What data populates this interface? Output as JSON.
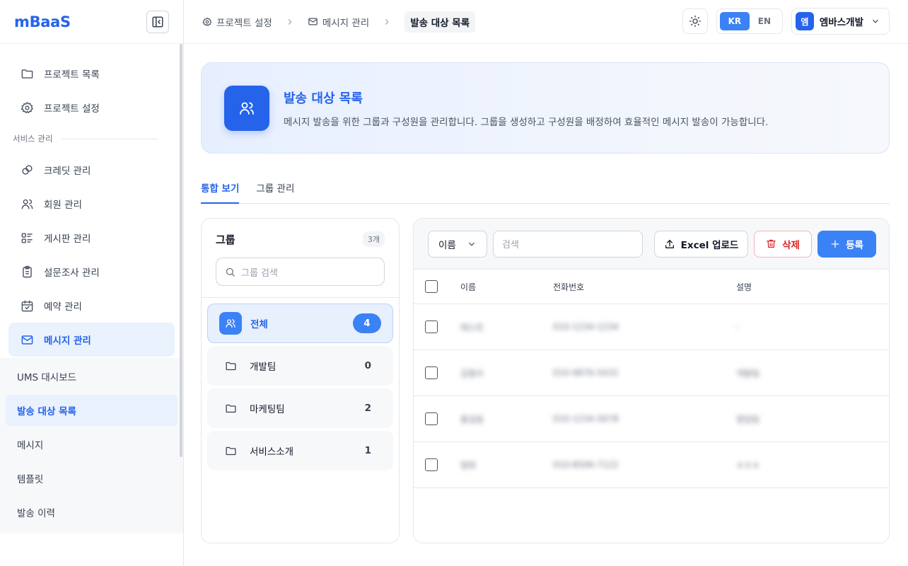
{
  "app": {
    "logo": "mBaaS"
  },
  "sidebar": {
    "items_top": [
      {
        "label": "프로젝트 목록",
        "icon": "folder-icon"
      },
      {
        "label": "프로젝트 설정",
        "icon": "gear-icon"
      }
    ],
    "section_label": "서비스 관리",
    "items_service": [
      {
        "label": "크레딧 관리",
        "icon": "coins-icon"
      },
      {
        "label": "회원 관리",
        "icon": "users-icon"
      },
      {
        "label": "게시판 관리",
        "icon": "list-icon"
      },
      {
        "label": "설문조사 관리",
        "icon": "clipboard-icon"
      },
      {
        "label": "예약 관리",
        "icon": "calendar-check-icon"
      },
      {
        "label": "메시지 관리",
        "icon": "mail-icon"
      }
    ],
    "submenu": [
      {
        "label": "UMS 대시보드"
      },
      {
        "label": "발송 대상 목록"
      },
      {
        "label": "메시지"
      },
      {
        "label": "템플릿"
      },
      {
        "label": "발송 이력"
      }
    ]
  },
  "breadcrumb": [
    {
      "label": "프로젝트 설정",
      "icon": "gear-icon"
    },
    {
      "label": "메시지 관리",
      "icon": "mail-icon"
    },
    {
      "label": "발송 대상 목록"
    }
  ],
  "header": {
    "lang": [
      "KR",
      "EN"
    ],
    "user_initial": "엠",
    "user_name": "엠바스개발"
  },
  "hero": {
    "title": "발송 대상 목록",
    "description": "메시지 발송을 위한 그룹과 구성원을 관리합니다. 그룹을 생성하고 구성원을 배정하여 효율적인 메시지 발송이 가능합니다."
  },
  "tabs": [
    {
      "label": "통합 보기"
    },
    {
      "label": "그룹 관리"
    }
  ],
  "groups": {
    "title": "그룹",
    "count": "3개",
    "search_placeholder": "그룹 검색",
    "items": [
      {
        "name": "전체",
        "count": "4"
      },
      {
        "name": "개발팀",
        "count": "0"
      },
      {
        "name": "마케팅팀",
        "count": "2"
      },
      {
        "name": "서비스소개",
        "count": "1"
      }
    ]
  },
  "toolbar": {
    "field_select": "이름",
    "search_placeholder": "검색",
    "excel_label": "Excel 업로드",
    "delete_label": "삭제",
    "add_label": "등록"
  },
  "table": {
    "columns": [
      "이름",
      "전화번호",
      "설명"
    ],
    "rows": [
      {
        "name": "테스트",
        "phone": "010-1234-1234",
        "desc": "-"
      },
      {
        "name": "김철수",
        "phone": "010-9876-5432",
        "desc": "개발팀"
      },
      {
        "name": "홍길동",
        "phone": "010-1234-5678",
        "desc": "영업팀"
      },
      {
        "name": "영희",
        "phone": "010-8506-7122",
        "desc": "ㅎㅎㅎ"
      }
    ]
  },
  "colors": {
    "accent": "#2563eb",
    "button": "#3b82f6",
    "danger": "#dc2626"
  }
}
